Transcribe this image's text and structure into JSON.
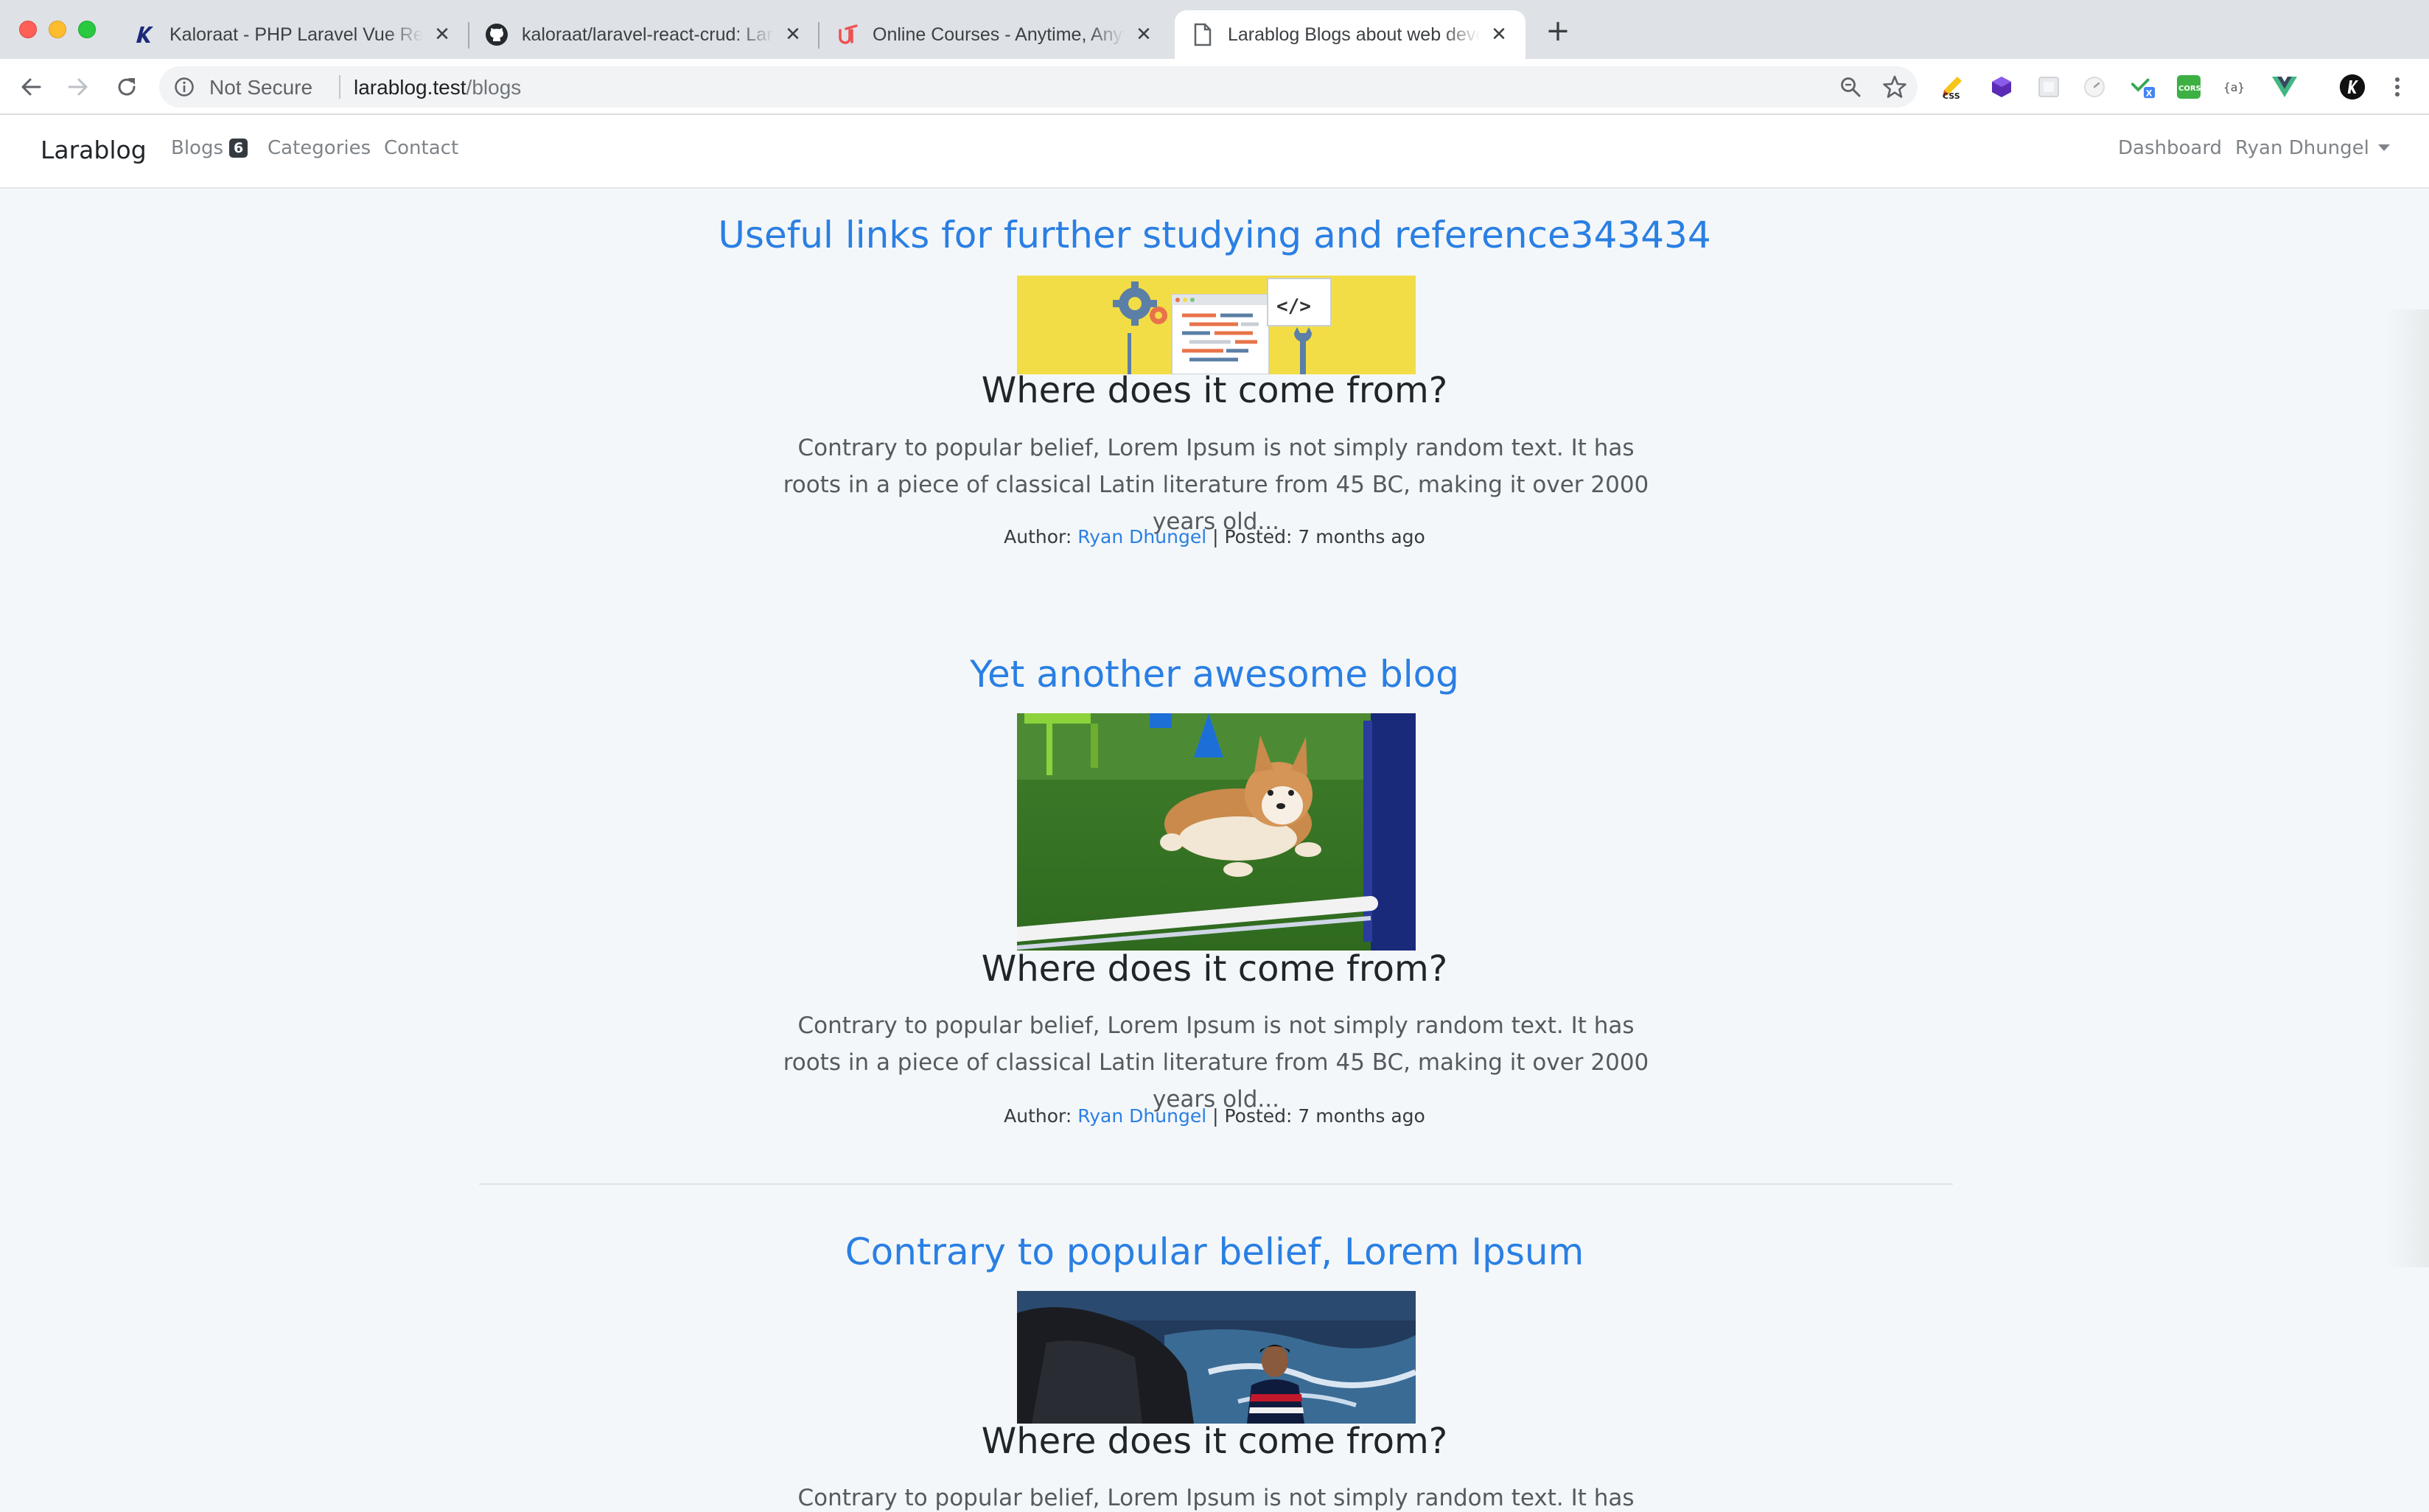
{
  "browser": {
    "tabs": [
      {
        "title": "Kaloraat - PHP Laravel Vue React",
        "favicon": "kaloraat-k-icon"
      },
      {
        "title": "kaloraat/laravel-react-crud: Laravel",
        "favicon": "github-icon"
      },
      {
        "title": "Online Courses - Anytime, Anywhere",
        "favicon": "udemy-icon"
      },
      {
        "title": "Larablog Blogs about web development",
        "favicon": "page-icon"
      }
    ],
    "new_tab": "+",
    "close_glyph": "✕",
    "security_label": "Not Secure",
    "url_host": "larablog.test",
    "url_path": "/blogs",
    "extensions": [
      "css-peeper",
      "purple-cube",
      "grey-square",
      "clock",
      "translate",
      "cors",
      "json-formatter",
      "vue-devtools",
      "kaloraat-avatar"
    ]
  },
  "site": {
    "brand": "Larablog",
    "nav": {
      "blogs": "Blogs",
      "blogs_count": "6",
      "categories": "Categories",
      "contact": "Contact",
      "dashboard": "Dashboard",
      "user": "Ryan Dhungel"
    }
  },
  "posts": [
    {
      "title": "Useful links for further studying and reference343434",
      "subtitle": "Where does it come from?",
      "excerpt": "Contrary to popular belief, Lorem Ipsum is not simply random text. It has roots in a piece of classical Latin literature from 45 BC, making it over 2000 years old...",
      "author_label": "Author:",
      "author": "Ryan Dhungel",
      "posted": "| Posted: 7 months ago",
      "image": "coding-tools-illustration"
    },
    {
      "title": "Yet another awesome blog",
      "subtitle": "Where does it come from?",
      "excerpt": "Contrary to popular belief, Lorem Ipsum is not simply random text. It has roots in a piece of classical Latin literature from 45 BC, making it over 2000 years old...",
      "author_label": "Author:",
      "author": "Ryan Dhungel",
      "posted": "| Posted: 7 months ago",
      "image": "corgi-jumping-photo"
    },
    {
      "title": "Contrary to popular belief, Lorem Ipsum",
      "subtitle": "Where does it come from?",
      "excerpt": "Contrary to popular belief, Lorem Ipsum is not simply random text. It has roots in a",
      "image": "man-by-sea-photo"
    }
  ],
  "colors": {
    "link": "#2a7fe3",
    "page_bg": "#f4f7f9",
    "tabstrip": "#dee1e6"
  }
}
